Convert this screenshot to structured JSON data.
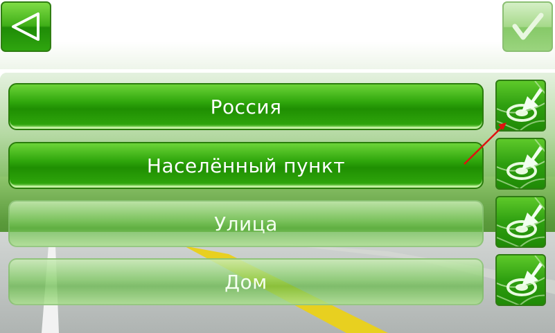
{
  "toolbar": {
    "back_icon": "back-triangle-icon",
    "confirm_icon": "checkmark-icon"
  },
  "rows": [
    {
      "label": "Россия",
      "state": "active",
      "map_icon": "map-pin-icon"
    },
    {
      "label": "Населённый пункт",
      "state": "active",
      "map_icon": "map-pin-icon"
    },
    {
      "label": "Улица",
      "state": "inactive",
      "map_icon": "map-pin-icon"
    },
    {
      "label": "Дом",
      "state": "inactive",
      "map_icon": "map-pin-icon"
    }
  ],
  "colors": {
    "accent": "#2fa60c",
    "accent_dark": "#1f8f02",
    "annotation_arrow": "#e01010"
  }
}
